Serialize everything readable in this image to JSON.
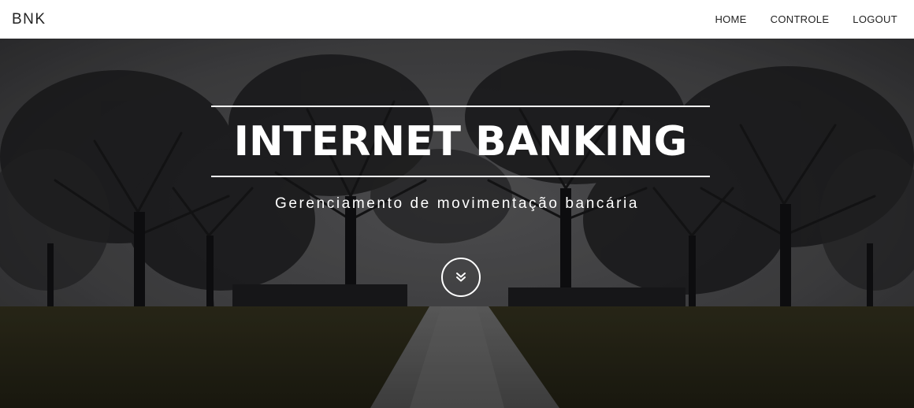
{
  "navbar": {
    "brand": "BNK",
    "links": [
      {
        "label": "HOME"
      },
      {
        "label": "CONTROLE"
      },
      {
        "label": "LOGOUT"
      }
    ]
  },
  "hero": {
    "title": "INTERNET BANKING",
    "subtitle": "Gerenciamento de movimentação bancária",
    "scroll_icon": "double-chevron-down-icon"
  },
  "colors": {
    "navbar_bg": "#ffffff",
    "nav_text": "#222222",
    "hero_text": "#ffffff",
    "sky": "#4a4a4c",
    "grass": "#3a3618"
  }
}
